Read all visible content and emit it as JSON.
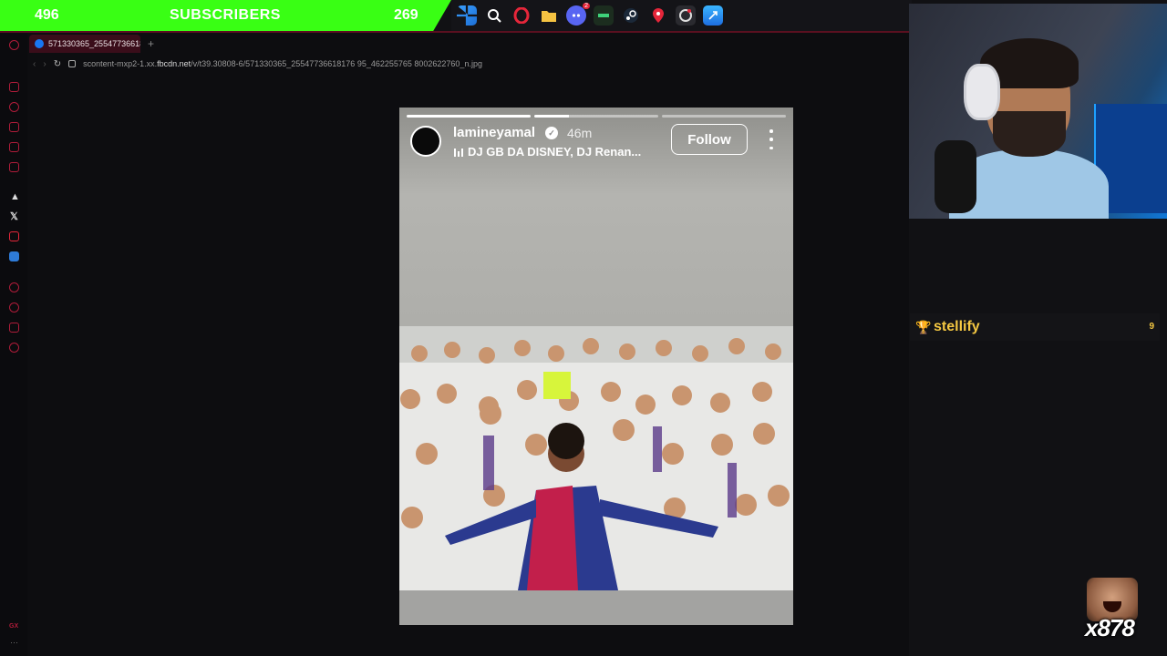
{
  "stream": {
    "subscribers_left": "496",
    "subscribers_label": "SUBSCRIBERS",
    "subscribers_right": "269"
  },
  "taskbar": {
    "icons": [
      "windows-start-icon",
      "search-icon",
      "opera-icon",
      "folder-icon",
      "discord-icon",
      "app-icon",
      "steam-icon",
      "maps-icon",
      "opera-gx-icon",
      "app-store-icon"
    ],
    "discord_badge": "2"
  },
  "browser": {
    "tab_title": "571330365_25547736618",
    "url_prefix": "scontent-mxp2-1.xx.",
    "url_domain": "fbcdn.net",
    "url_path": "/v/t39.30808-6/571330365_25547736618176 95_462255765 8002622760_n.jpg",
    "sidebar_icons": [
      "opera-gx-icon",
      "messenger-icon",
      "reload-icon",
      "bag-icon",
      "twitch-icon",
      "mail-icon",
      "arc-icon",
      "x-icon",
      "youtube-icon",
      "bitwarden-icon",
      "play-icon",
      "clock-icon",
      "paint-icon",
      "settings-icon",
      "gx-icon",
      "more-icon"
    ]
  },
  "story": {
    "username": "lamineyamal",
    "time_ago": "46m",
    "music": "DJ GB DA DISNEY, DJ Renan...",
    "follow_label": "Follow",
    "progress_segments": 3,
    "progress_active": 1
  },
  "overlay": {
    "alert_name": "stellify",
    "alert_count": "9",
    "emote_combo": "x878"
  },
  "colors": {
    "banner_green": "#39ff14",
    "accent_red": "#b01c3a",
    "gold": "#f5c842"
  }
}
